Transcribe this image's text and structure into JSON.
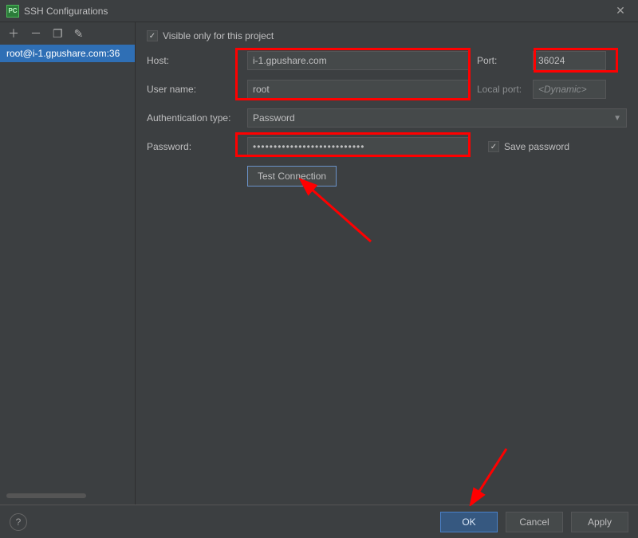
{
  "title": "SSH Configurations",
  "toolbar_icons": [
    "+",
    "−",
    "copy",
    "edit"
  ],
  "list": {
    "items": [
      "root@i-1.gpushare.com:36"
    ]
  },
  "form": {
    "visible_only_label": "Visible only for this project",
    "visible_only_checked": true,
    "host_label": "Host:",
    "host_value": "i-1.gpushare.com",
    "port_label": "Port:",
    "port_value": "36024",
    "user_label": "User name:",
    "user_value": "root",
    "local_port_label": "Local port:",
    "local_port_placeholder": "<Dynamic>",
    "auth_label": "Authentication type:",
    "auth_value": "Password",
    "password_label": "Password:",
    "password_value": "•••••••••••••••••••••••••••",
    "save_pw_label": "Save password",
    "save_pw_checked": true,
    "test_connection_label": "Test Connection"
  },
  "footer": {
    "ok": "OK",
    "cancel": "Cancel",
    "apply": "Apply"
  }
}
